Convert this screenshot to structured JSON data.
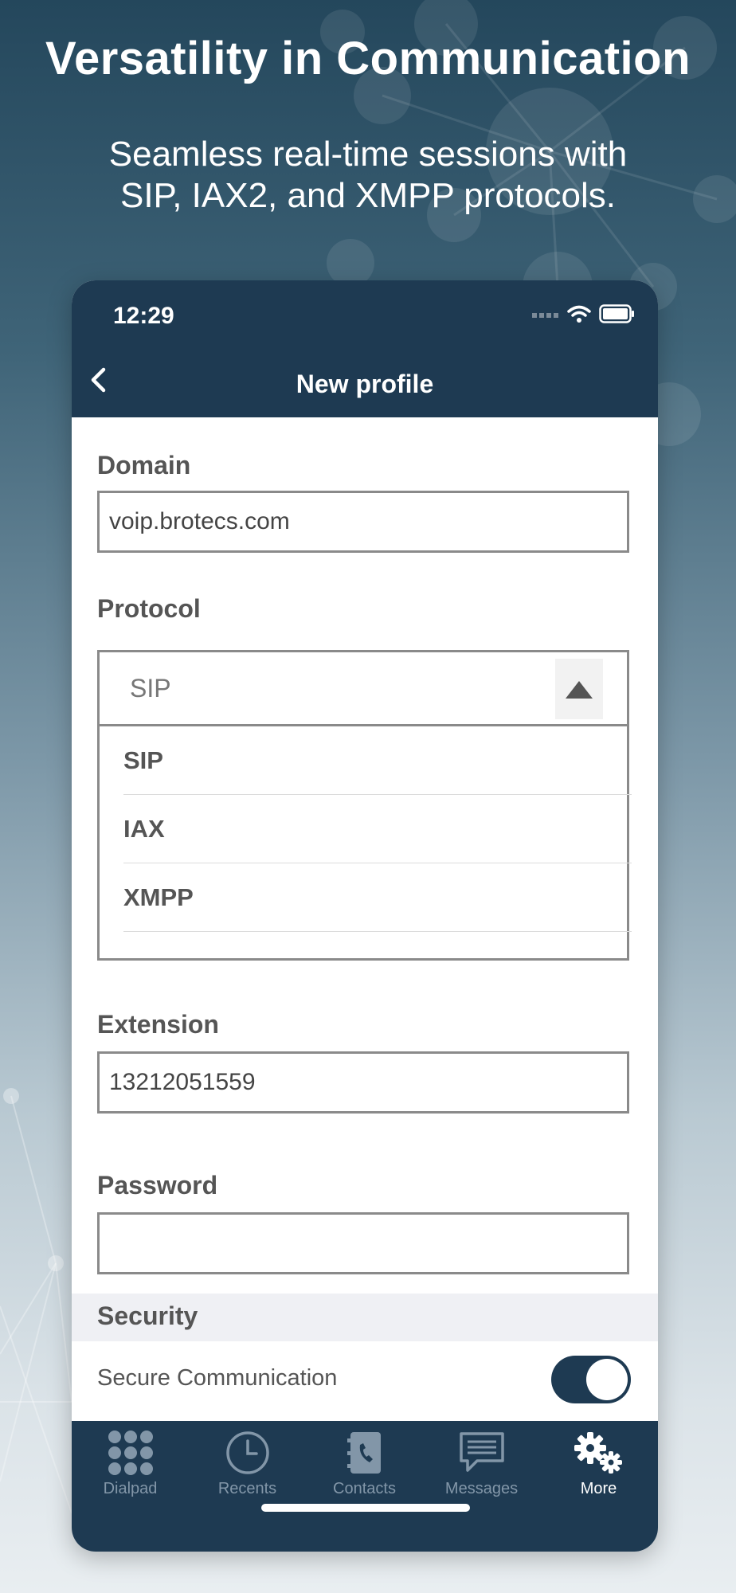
{
  "marketing": {
    "headline": "Versatility in Communication",
    "subline": "Seamless real-time sessions with SIP, IAX2, and XMPP protocols."
  },
  "status_bar": {
    "time": "12:29"
  },
  "navbar": {
    "title": "New profile"
  },
  "form": {
    "domain_label": "Domain",
    "domain_value": "voip.brotecs.com",
    "protocol_label": "Protocol",
    "protocol_selected": "SIP",
    "protocol_options": [
      "SIP",
      "IAX",
      "XMPP"
    ],
    "extension_label": "Extension",
    "extension_value": "13212051559",
    "password_label": "Password",
    "password_value": ""
  },
  "security": {
    "header": "Security",
    "secure_label": "Secure Communication",
    "secure_enabled": true
  },
  "tabbar": {
    "tabs": [
      {
        "label": "Dialpad",
        "icon": "dialpad-icon",
        "active": false
      },
      {
        "label": "Recents",
        "icon": "clock-icon",
        "active": false
      },
      {
        "label": "Contacts",
        "icon": "contacts-book-icon",
        "active": false
      },
      {
        "label": "Messages",
        "icon": "message-bubble-icon",
        "active": false
      },
      {
        "label": "More",
        "icon": "gears-icon",
        "active": true
      }
    ]
  },
  "colors": {
    "navbar": "#1e3a52",
    "inactive_tab": "#8296a8",
    "active_tab": "#ffffff"
  }
}
